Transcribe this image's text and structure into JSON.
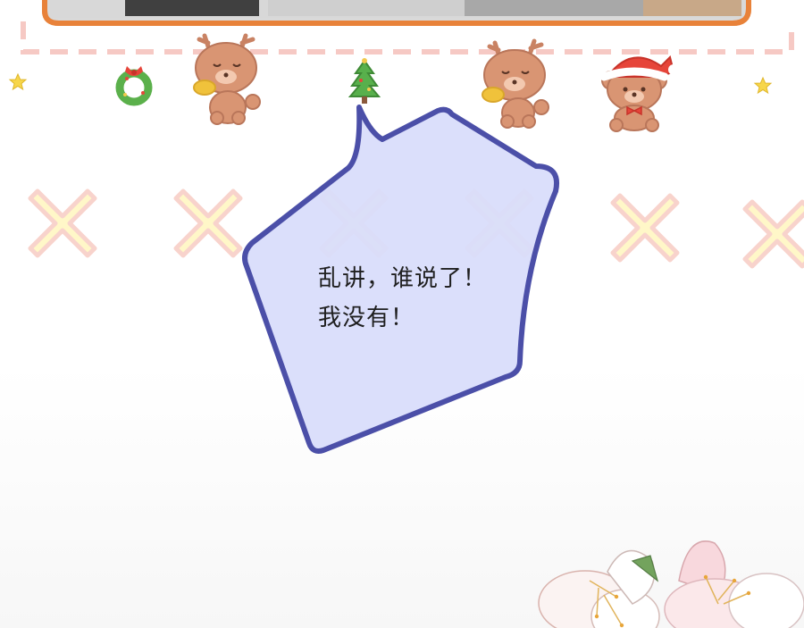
{
  "speech_bubble": {
    "lines": [
      "乱讲，谁说了！",
      "我没有！"
    ]
  },
  "colors": {
    "frame_border": "#e8823a",
    "frame_fill": "#d9d9d9",
    "dashed_pink": "#f6c9c4",
    "x_pattern_fill": "#fff7c8",
    "x_pattern_outline": "#f8d3cc",
    "bubble_fill": "#d9ddfb",
    "bubble_stroke": "#4b4fa8",
    "bear_brown": "#d99573",
    "text": "#1f1f1f"
  },
  "stickers": [
    "star-icon",
    "wreath-icon",
    "reindeer-bear-icon",
    "christmas-tree-icon",
    "reindeer-bear-icon",
    "santa-bear-icon",
    "star-icon"
  ],
  "decorations": [
    "cherry-blossom-flowers"
  ]
}
